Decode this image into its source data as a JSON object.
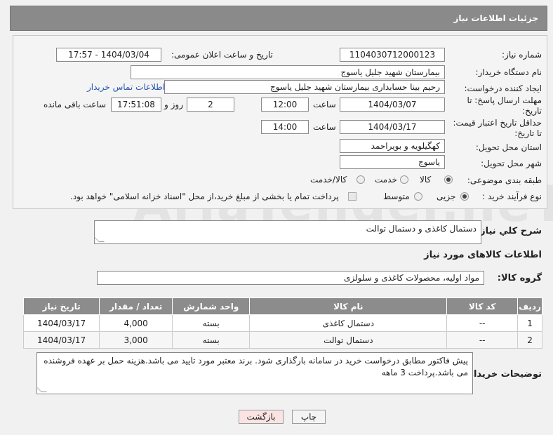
{
  "header": {
    "title": "جزئیات اطلاعات نیاز"
  },
  "form": {
    "need_number_label": "شماره نیاز:",
    "need_number": "1104030712000123",
    "announce_label": "تاریخ و ساعت اعلان عمومی:",
    "announce_value": "1404/03/04 - 17:57",
    "buyer_org_label": "نام دستگاه خریدار:",
    "buyer_org": "بیمارستان شهید جلیل یاسوج",
    "requester_label": "ایجاد کننده درخواست:",
    "requester": "رحیم بینا حسابداری بیمارستان شهید جلیل یاسوج",
    "contact_link": "اطلاعات تماس خریدار",
    "deadline_label_1": "مهلت ارسال پاسخ: تا",
    "deadline_label_2": "تاریخ:",
    "deadline_date": "1404/03/07",
    "time_label": "ساعت",
    "deadline_time": "12:00",
    "days_value": "2",
    "days_label": "روز و",
    "remaining_time": "17:51:08",
    "remaining_label": "ساعت باقی مانده",
    "validity_label_1": "حداقل تاریخ اعتبار قیمت:",
    "validity_label_2": "تا تاریخ:",
    "validity_date": "1404/03/17",
    "validity_time_label": "ساعت",
    "validity_time": "14:00",
    "province_label": "استان محل تحویل:",
    "province": "کهگیلویه و بویراحمد",
    "city_label": "شهر محل تحویل:",
    "city": "یاسوج",
    "category_label": "طبقه بندی موضوعی:",
    "category_options": [
      "کالا",
      "خدمت",
      "کالا/خدمت"
    ],
    "category_selected": "کالا",
    "process_label": "نوع فرآیند خرید :",
    "process_options": [
      "جزیی",
      "متوسط"
    ],
    "process_selected": "جزیی",
    "payment_note": "پرداخت تمام یا بخشی از مبلغ خرید،از محل \"اسناد خزانه اسلامی\" خواهد بود."
  },
  "description": {
    "label": "شرح کلي نياز:",
    "value": "دستمال کاغذی و  دستمال توالت"
  },
  "goods": {
    "section_title": "اطلاعات کالاهای مورد نیاز",
    "group_label": "گروه کالا:",
    "group_value": "مواد اولیه، محصولات کاغذی و سلولزی",
    "columns": [
      "ردیف",
      "کد کالا",
      "نام کالا",
      "واحد شمارش",
      "تعداد / مقدار",
      "تاریخ نیاز"
    ],
    "rows": [
      {
        "index": "1",
        "code": "--",
        "name": "دستمال کاغذی",
        "unit": "بسته",
        "qty": "4,000",
        "date": "1404/03/17"
      },
      {
        "index": "2",
        "code": "--",
        "name": "دستمال توالت",
        "unit": "بسته",
        "qty": "3,000",
        "date": "1404/03/17"
      }
    ]
  },
  "buyer_notes": {
    "label": "توضیحات خریدار:",
    "value": "پیش فاکتور مطابق درخواست خرید در سامانه بارگذاری شود. برند معتبر مورد تایید می باشد.هزینه حمل بر عهده فروشنده می باشد.پرداخت 3 ماهه"
  },
  "buttons": {
    "print": "چاپ",
    "back": "بازگشت"
  },
  "watermark": "AriaTender.neT",
  "colors": {
    "header_bg": "#8a8a8a",
    "link": "#2a56b0",
    "back_button": "#fbe3e3"
  }
}
